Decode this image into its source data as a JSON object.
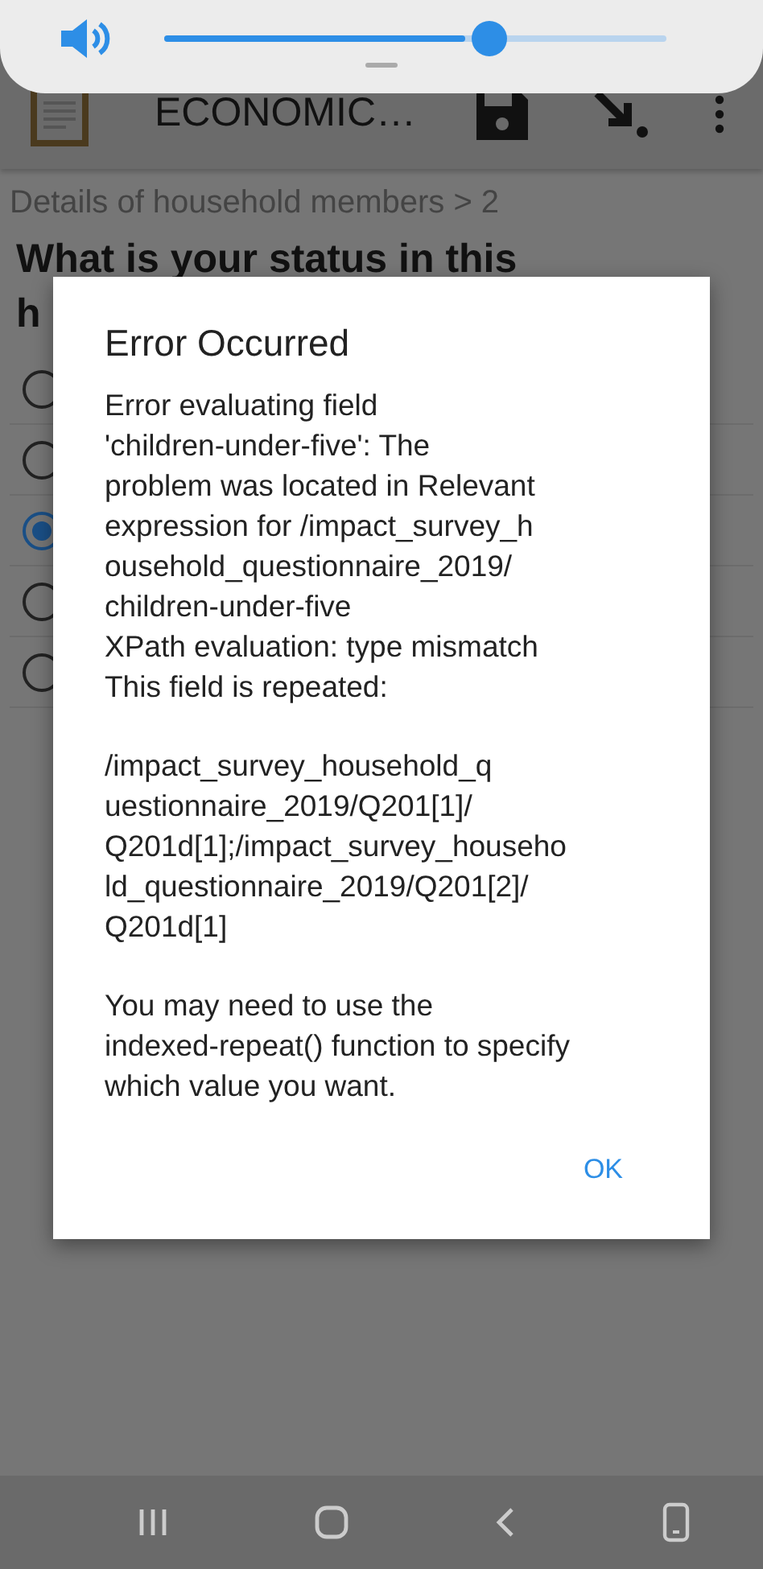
{
  "volume_panel": {
    "level": 0.6
  },
  "app_bar": {
    "title": "ECONOMIC…"
  },
  "breadcrumb": "Details of household members > 2",
  "question_lines": [
    "What is your status in this",
    "h"
  ],
  "options": [
    {
      "selected": false
    },
    {
      "selected": false
    },
    {
      "selected": true
    },
    {
      "selected": false
    },
    {
      "selected": false
    }
  ],
  "dialog": {
    "title": "Error Occurred",
    "paragraphs": [
      [
        "Error evaluating field",
        "'children-under-five': The",
        "problem was located in Relevant",
        "expression for /impact_survey_h",
        "ousehold_questionnaire_2019/",
        "children-under-five",
        "XPath evaluation: type mismatch",
        "This field is repeated:"
      ],
      [
        "/impact_survey_household_q",
        "uestionnaire_2019/Q201[1]/",
        "Q201d[1];/impact_survey_househo",
        "ld_questionnaire_2019/Q201[2]/",
        "Q201d[1]"
      ],
      [
        "You may need to use the",
        "indexed-repeat() function to specify",
        "which value you want."
      ]
    ],
    "button": "OK"
  }
}
